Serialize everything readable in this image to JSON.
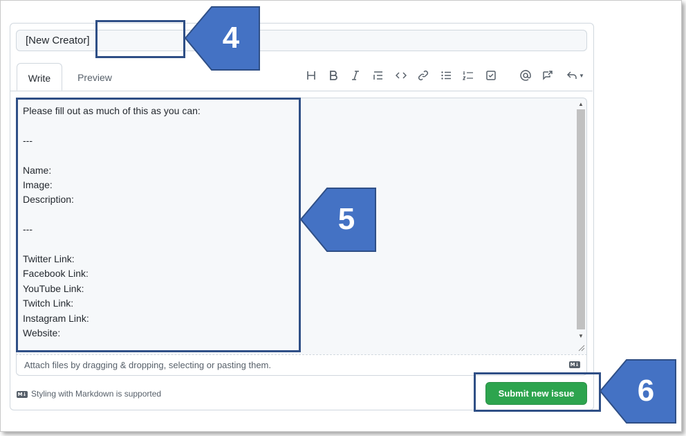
{
  "issue_form": {
    "title_value": "[New Creator]",
    "tabs": {
      "write": "Write",
      "preview": "Preview"
    },
    "toolbar": [
      {
        "icon": "heading-icon"
      },
      {
        "icon": "bold-icon"
      },
      {
        "icon": "italic-icon"
      },
      {
        "icon": "quote-icon"
      },
      {
        "icon": "code-icon"
      },
      {
        "icon": "link-icon"
      },
      {
        "icon": "bulleted-list-icon"
      },
      {
        "icon": "numbered-list-icon"
      },
      {
        "icon": "task-list-icon"
      },
      {
        "icon": "mention-icon"
      },
      {
        "icon": "cross-reference-icon"
      },
      {
        "icon": "reply-icon"
      }
    ],
    "body_text": "Please fill out as much of this as you can:\n\n---\n\nName:\nImage:\nDescription:\n\n---\n\nTwitter Link:\nFacebook Link:\nYouTube Link:\nTwitch Link:\nInstagram Link:\nWebsite:",
    "attach_hint": "Attach files by dragging & dropping, selecting or pasting them.",
    "markdown_note": "Styling with Markdown is supported",
    "submit_label": "Submit new issue"
  },
  "callouts": {
    "title": "4",
    "body": "5",
    "submit": "6"
  },
  "colors": {
    "callout": "#4472c4",
    "callout_border": "#2f4f86",
    "submit": "#2da44e"
  }
}
